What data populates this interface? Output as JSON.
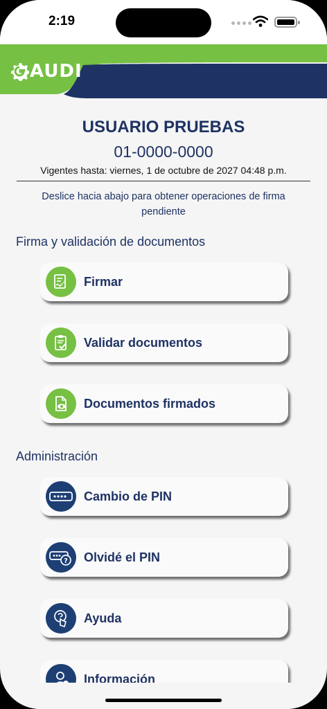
{
  "status_bar": {
    "time": "2:19"
  },
  "header": {
    "logo_text": "AUDI",
    "colors": {
      "green": "#76c043",
      "navy": "#1e3263"
    }
  },
  "user": {
    "name": "USUARIO PRUEBAS",
    "id": "01-0000-0000",
    "valid_until": "Vigentes hasta: viernes, 1 de octubre de 2027 04:48 p.m."
  },
  "hint": "Deslice hacia abajo para obtener operaciones de firma pendiente",
  "sections": [
    {
      "title": "Firma y validación de documentos",
      "items": [
        {
          "label": "Firmar",
          "icon": "sign-document-icon"
        },
        {
          "label": "Validar documentos",
          "icon": "clipboard-check-icon"
        },
        {
          "label": "Documentos firmados",
          "icon": "document-view-icon"
        }
      ]
    },
    {
      "title": "Administración",
      "items": [
        {
          "label": "Cambio de PIN",
          "icon": "pin-field-icon"
        },
        {
          "label": "Olvidé el PIN",
          "icon": "pin-help-icon"
        },
        {
          "label": "Ayuda",
          "icon": "touch-help-icon"
        },
        {
          "label": "Información",
          "icon": "user-info-icon"
        }
      ]
    }
  ]
}
